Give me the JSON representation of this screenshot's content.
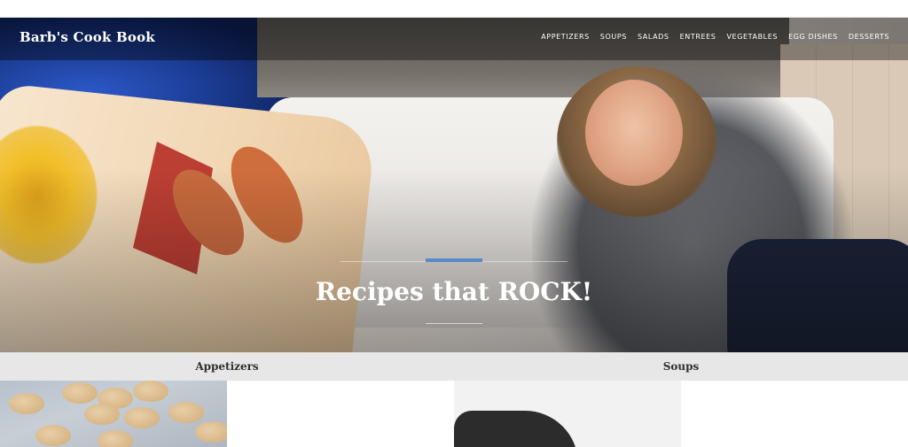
{
  "site": {
    "brand": "Barb's Cook Book"
  },
  "nav": {
    "items": [
      "APPETIZERS",
      "SOUPS",
      "SALADS",
      "ENTREES",
      "VEGETABLES",
      "EGG DISHES",
      "DESSERTS"
    ]
  },
  "hero": {
    "headline": "Recipes that ROCK!",
    "accent_color": "#5a8ac6"
  },
  "categories": [
    {
      "label": "Appetizers"
    },
    {
      "label": "Soups"
    }
  ]
}
